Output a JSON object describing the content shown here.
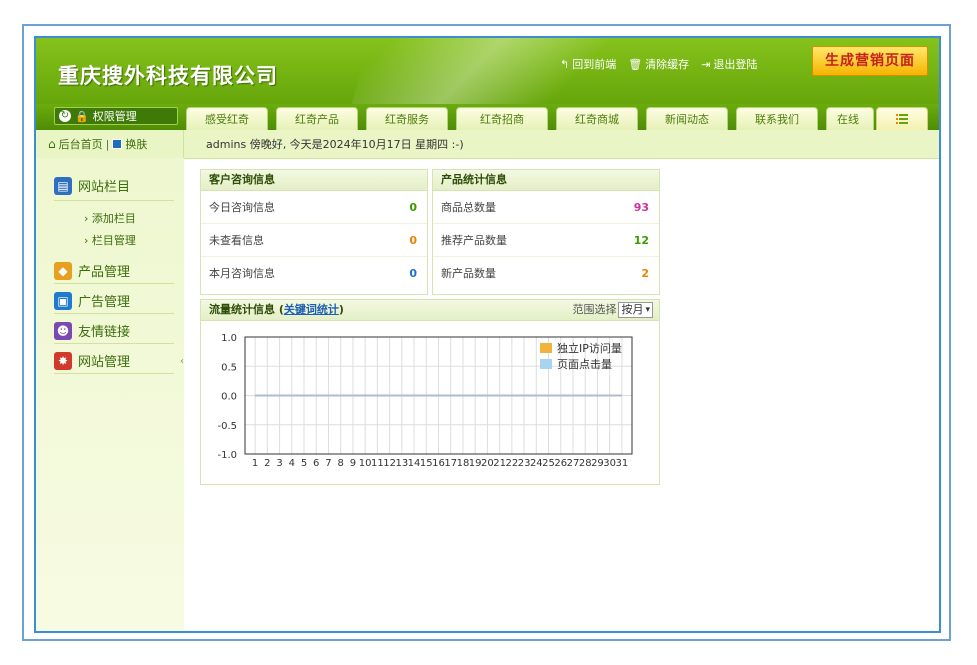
{
  "header": {
    "company_name": "重庆搜外科技有限公司",
    "links": [
      {
        "icon": "back-arrow-icon",
        "label": "回到前端"
      },
      {
        "icon": "trash-icon",
        "label": "清除缓存"
      },
      {
        "icon": "logout-icon",
        "label": "退出登陆"
      }
    ],
    "generate_button": "生成营销页面"
  },
  "permissions_button": "权限管理",
  "tabs": [
    "感受红奇",
    "红奇产品",
    "红奇服务",
    "红奇招商",
    "红奇商城",
    "新闻动态",
    "联系我们",
    "在线"
  ],
  "subbar": {
    "home_link": "后台首页",
    "separator": "|",
    "skin_link": "换肤",
    "greeting": "admins 傍晚好, 今天是2024年10月17日 星期四 :-)"
  },
  "sidebar": {
    "section1": "网站栏目",
    "sub_items": [
      "添加栏目",
      "栏目管理"
    ],
    "items": [
      "产品管理",
      "广告管理",
      "友情链接",
      "网站管理"
    ],
    "collapse_glyph": "‹"
  },
  "consult_panel": {
    "title": "客户咨询信息",
    "rows": [
      {
        "label": "今日咨询信息",
        "value": "0",
        "color": "#3a9a00"
      },
      {
        "label": "未查看信息",
        "value": "0",
        "color": "#f08000"
      },
      {
        "label": "本月咨询信息",
        "value": "0",
        "color": "#1d6fd0"
      }
    ]
  },
  "product_panel": {
    "title": "产品统计信息",
    "rows": [
      {
        "label": "商品总数量",
        "value": "93",
        "color": "#cc3399"
      },
      {
        "label": "推荐产品数量",
        "value": "12",
        "color": "#3a9a00"
      },
      {
        "label": "新产品数量",
        "value": "2",
        "color": "#f08000"
      }
    ]
  },
  "traffic_panel": {
    "title": "流量统计信息",
    "open_paren": "(",
    "keyword_link": "关键词统计",
    "close_paren": ")",
    "range_label": "范围选择",
    "range_value": "按月"
  },
  "chart_data": {
    "type": "line",
    "x": [
      1,
      2,
      3,
      4,
      5,
      6,
      7,
      8,
      9,
      10,
      11,
      12,
      13,
      14,
      15,
      16,
      17,
      18,
      19,
      20,
      21,
      22,
      23,
      24,
      25,
      26,
      27,
      28,
      29,
      30,
      31
    ],
    "ylim": [
      -1.0,
      1.0
    ],
    "yticks": [
      "1.0",
      "0.5",
      "0.0",
      "-0.5",
      "-1.0"
    ],
    "series": [
      {
        "name": "独立IP访问量",
        "color": "#f0b43c",
        "values": [
          0,
          0,
          0,
          0,
          0,
          0,
          0,
          0,
          0,
          0,
          0,
          0,
          0,
          0,
          0,
          0,
          0,
          0,
          0,
          0,
          0,
          0,
          0,
          0,
          0,
          0,
          0,
          0,
          0,
          0,
          0
        ]
      },
      {
        "name": "页面点击量",
        "color": "#a8d4f0",
        "values": [
          0,
          0,
          0,
          0,
          0,
          0,
          0,
          0,
          0,
          0,
          0,
          0,
          0,
          0,
          0,
          0,
          0,
          0,
          0,
          0,
          0,
          0,
          0,
          0,
          0,
          0,
          0,
          0,
          0,
          0,
          0
        ]
      }
    ],
    "grid": true,
    "legend": "top-right"
  }
}
